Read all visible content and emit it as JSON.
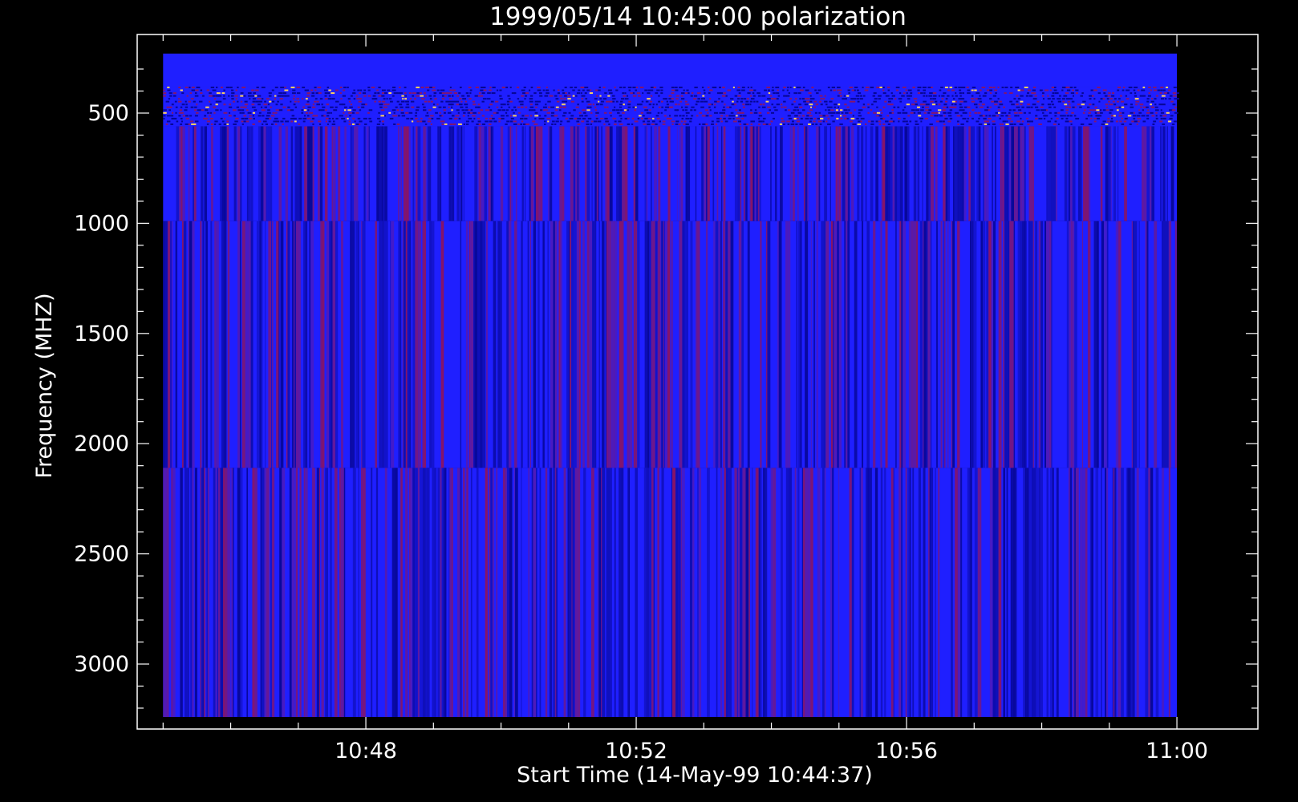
{
  "chart_data": {
    "type": "heatmap",
    "title": "1999/05/14 10:45:00 polarization",
    "xlabel": "Start Time (14-May-99 10:44:37)",
    "ylabel": "Frequency (MHZ)",
    "x_ticks": [
      {
        "value": "10:48"
      },
      {
        "value": "10:52"
      },
      {
        "value": "10:56"
      },
      {
        "value": "11:00"
      }
    ],
    "y_ticks": [
      {
        "value": 500
      },
      {
        "value": 1000
      },
      {
        "value": 1500
      },
      {
        "value": 2000
      },
      {
        "value": 2500
      },
      {
        "value": 3000
      }
    ],
    "x_range": [
      "10:44:37",
      "11:00:00"
    ],
    "x_data_range": [
      "10:45:00",
      "11:00:00"
    ],
    "y_range": [
      3300,
      150
    ],
    "y_data_range": [
      3240,
      230
    ],
    "frequency_bands": [
      {
        "from": 230,
        "to": 380,
        "level": "uniform"
      },
      {
        "from": 380,
        "to": 560,
        "level": "noisy"
      },
      {
        "from": 560,
        "to": 990,
        "level": "striped"
      },
      {
        "from": 990,
        "to": 2110,
        "level": "striped"
      },
      {
        "from": 2110,
        "to": 3240,
        "level": "striped"
      }
    ],
    "colors": {
      "background": "#000000",
      "base": "#1f1fff",
      "low": "#00007a",
      "high": "#b0102a",
      "peak": "#ffd060",
      "axes": "#ffffff"
    }
  }
}
